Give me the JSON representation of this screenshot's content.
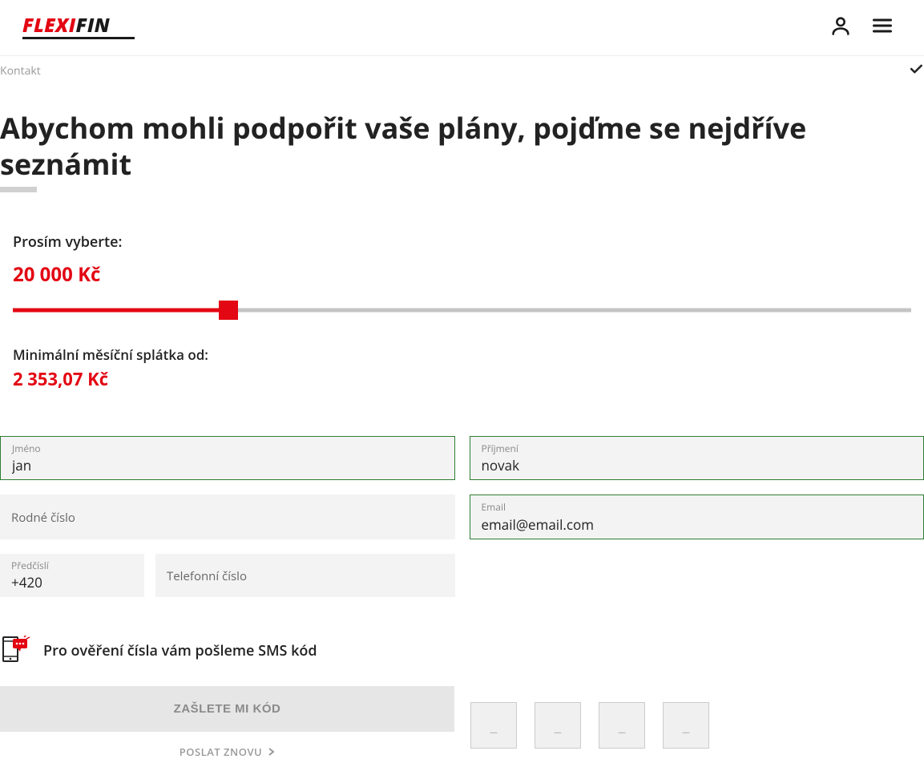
{
  "brand": {
    "name_red": "FLEXI",
    "name_black": "FIN"
  },
  "breadcrumb": {
    "label": "Kontakt"
  },
  "page": {
    "title": "Abychom mohli podpořit vaše plány, pojďme se nejdříve seznámit"
  },
  "slider": {
    "select_label": "Prosím vyberte:",
    "amount_display": "20 000 Kč",
    "fill_percent": 24,
    "monthly_label": "Minimální měsíční splátka od:",
    "monthly_display": "2 353,07 Kč"
  },
  "form": {
    "first_name": {
      "label": "Jméno",
      "value": "jan"
    },
    "last_name": {
      "label": "Příjmení",
      "value": "novak"
    },
    "birth_no": {
      "label": "Rodné číslo",
      "value": ""
    },
    "email": {
      "label": "Email",
      "value": "email@email.com"
    },
    "prefix": {
      "label": "Předčíslí",
      "value": "+420"
    },
    "phone": {
      "label": "Telefonní číslo",
      "value": ""
    }
  },
  "sms": {
    "notice": "Pro ověření čísla vám pošleme SMS kód",
    "send_label": "ZAŠLETE MI KÓD",
    "resend_label": "POSLAT ZNOVU",
    "code_placeholder": "_"
  }
}
